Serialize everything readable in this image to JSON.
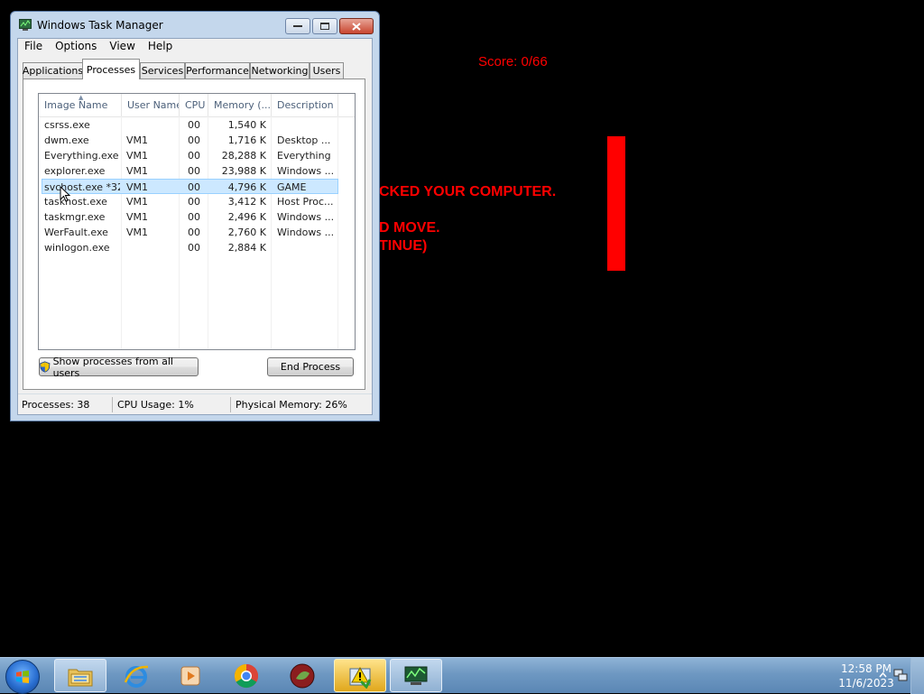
{
  "game": {
    "score": "Score: 0/66",
    "line1": "CKED YOUR COMPUTER.",
    "line2": "D MOVE.",
    "line3": "TINUE)"
  },
  "window": {
    "title": "Windows Task Manager",
    "menu": [
      "File",
      "Options",
      "View",
      "Help"
    ],
    "tabs": [
      "Applications",
      "Processes",
      "Services",
      "Performance",
      "Networking",
      "Users"
    ],
    "active_tab": "Processes",
    "columns": [
      "Image Name",
      "User Name",
      "CPU",
      "Memory (...",
      "Description"
    ],
    "rows": [
      {
        "image": "csrss.exe",
        "user": "",
        "cpu": "00",
        "mem": "1,540 K",
        "desc": ""
      },
      {
        "image": "dwm.exe",
        "user": "VM1",
        "cpu": "00",
        "mem": "1,716 K",
        "desc": "Desktop ..."
      },
      {
        "image": "Everything.exe",
        "user": "VM1",
        "cpu": "00",
        "mem": "28,288 K",
        "desc": "Everything"
      },
      {
        "image": "explorer.exe",
        "user": "VM1",
        "cpu": "00",
        "mem": "23,988 K",
        "desc": "Windows ..."
      },
      {
        "image": "svchost.exe *32",
        "user": "VM1",
        "cpu": "00",
        "mem": "4,796 K",
        "desc": "GAME",
        "selected": true
      },
      {
        "image": "taskhost.exe",
        "user": "VM1",
        "cpu": "00",
        "mem": "3,412 K",
        "desc": "Host Proc..."
      },
      {
        "image": "taskmgr.exe",
        "user": "VM1",
        "cpu": "00",
        "mem": "2,496 K",
        "desc": "Windows ..."
      },
      {
        "image": "WerFault.exe",
        "user": "VM1",
        "cpu": "00",
        "mem": "2,760 K",
        "desc": "Windows ..."
      },
      {
        "image": "winlogon.exe",
        "user": "",
        "cpu": "00",
        "mem": "2,884 K",
        "desc": ""
      }
    ],
    "show_all_label": "Show processes from all users",
    "end_process_label": "End Process",
    "status": {
      "processes": "Processes: 38",
      "cpu": "CPU Usage: 1%",
      "memory": "Physical Memory: 26%"
    }
  },
  "taskbar": {
    "pinned": [
      "windows-explorer-icon",
      "internet-explorer-icon",
      "media-player-icon",
      "chrome-icon",
      "game-app-icon",
      "warning-app-icon",
      "task-manager-icon"
    ],
    "clock_time": "12:58 PM",
    "clock_date": "11/6/2023"
  }
}
